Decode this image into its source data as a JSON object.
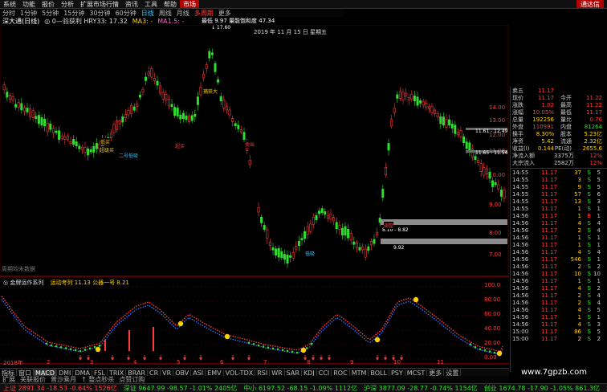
{
  "menu": {
    "items": [
      "系统",
      "功能",
      "报价",
      "分析",
      "扩展市场行情",
      "资讯",
      "工具",
      "帮助",
      "市场"
    ],
    "login": "通达信"
  },
  "periods": {
    "items": [
      "分时",
      "1分钟",
      "5分钟",
      "15分钟",
      "30分钟",
      "60分钟",
      "日线",
      "周线",
      "月线",
      "多周期",
      "更多"
    ],
    "active_index": 6
  },
  "indicator_line": {
    "name": "深大通(日线)",
    "text": "◎ 0—验获利 HRY33: 17.32",
    "ma": "MA3: -",
    "ma2": "MA1.5: -"
  },
  "peak_box": {
    "line1": "最低 9.97  量能饱和度 47.34",
    "line2": "↓ 17.60",
    "date": "2019 年 11 月 15 日 星期五"
  },
  "main_chart": {
    "annotations": [
      {
        "text": "超级买",
        "color": "#ffd000"
      },
      {
        "text": "低买",
        "color": "#ffd000"
      },
      {
        "text": "超买",
        "color": "#ff3b3b"
      },
      {
        "text": "卖出",
        "color": "#ff3b3b"
      },
      {
        "text": "二号低吸",
        "color": "#2ec7ff"
      },
      {
        "text": "捕获大",
        "color": "#ffd000"
      },
      {
        "text": "低吸",
        "color": "#2ec7ff"
      },
      {
        "text": "调整",
        "color": "#ff3b3b"
      }
    ],
    "price_labels": [
      "14.00",
      "13.00",
      "12.00",
      "11.00",
      "10.00",
      "9.00",
      "8.00",
      "7.00"
    ],
    "range_labels": [
      "11.61 - 12.49",
      "11.65 - 11.54",
      "8.10 - 8.82",
      "9.92"
    ],
    "bottom_note": "周期均未数据"
  },
  "sub_chart": {
    "title": "◎ 金牌运作系列",
    "text": "运动考列 11.13 公器一号 8.21",
    "price_labels": [
      "100.0",
      "80.00",
      "60.00",
      "40.00",
      "20.00",
      "0.00"
    ],
    "x_labels": [
      "2018年",
      "2",
      "3",
      "4",
      "5",
      "6",
      "7",
      "8",
      "9",
      "10",
      "11"
    ]
  },
  "quote": {
    "rows": [
      {
        "l1": "卖五",
        "v1": "11.17",
        "l2": "",
        "v2": "",
        "c1": "red",
        "c2": "red"
      },
      {
        "l1": "现价",
        "v1": "11.17",
        "l2": "今开",
        "v2": "11.22",
        "c1": "red",
        "c2": "red"
      },
      {
        "l1": "涨跌",
        "v1": "1.02",
        "l2": "最高",
        "v2": "11.22",
        "c1": "red",
        "c2": "red"
      },
      {
        "l1": "涨幅",
        "v1": "10.05%",
        "l2": "最低",
        "v2": "11.17",
        "c1": "red",
        "c2": "red"
      },
      {
        "l1": "总量",
        "v1": "192256",
        "l2": "量比",
        "v2": "0.76",
        "c1": "yellow",
        "c2": "red"
      },
      {
        "l1": "外盘",
        "v1": "110991",
        "l2": "内盘",
        "v2": "81264",
        "c1": "red",
        "c2": "green"
      },
      {
        "l1": "换手",
        "v1": "8.30%",
        "l2": "股本",
        "v2": "5.23亿",
        "c1": "yellow",
        "c2": "yellow"
      },
      {
        "l1": "净资",
        "v1": "5.42",
        "l2": "流通",
        "v2": "2.32亿",
        "c1": "yellow",
        "c2": "yellow"
      },
      {
        "l1": "收益(I)",
        "v1": "0.144",
        "l2": "PE(动)",
        "v2": "2655.6",
        "c1": "yellow",
        "c2": "yellow"
      },
      {
        "l1": "净流入额",
        "v1": "",
        "l2": "3375万",
        "v2": "12%",
        "c1": "red",
        "c2": "red"
      },
      {
        "l1": "大宗流入",
        "v1": "",
        "l2": "2582万",
        "v2": "12%",
        "c1": "red",
        "c2": "red"
      }
    ]
  },
  "trades": [
    {
      "t": "14:55",
      "p": "11.17",
      "v": "37",
      "s": "S",
      "n": "5"
    },
    {
      "t": "14:55",
      "p": "11.17",
      "v": "3",
      "s": "S",
      "n": "5"
    },
    {
      "t": "14:55",
      "p": "11.17",
      "v": "9",
      "s": "S",
      "n": "5"
    },
    {
      "t": "14:55",
      "p": "11.17",
      "v": "57",
      "s": "S",
      "n": "6"
    },
    {
      "t": "14:55",
      "p": "11.17",
      "v": "13",
      "s": "S",
      "n": "3"
    },
    {
      "t": "14:55",
      "p": "11.17",
      "v": "1",
      "s": "S",
      "n": "1"
    },
    {
      "t": "14:56",
      "p": "11.17",
      "v": "1",
      "s": "B",
      "n": "1"
    },
    {
      "t": "14:56",
      "p": "11.17",
      "v": "4",
      "s": "S",
      "n": "4"
    },
    {
      "t": "14:56",
      "p": "11.17",
      "v": "2",
      "s": "S",
      "n": "4"
    },
    {
      "t": "14:56",
      "p": "11.17",
      "v": "1",
      "s": "S",
      "n": "1"
    },
    {
      "t": "14:56",
      "p": "11.17",
      "v": "1",
      "s": "S",
      "n": "1"
    },
    {
      "t": "14:56",
      "p": "11.17",
      "v": "4",
      "s": "S",
      "n": "4"
    },
    {
      "t": "14:56",
      "p": "11.17",
      "v": "546",
      "s": "S",
      "n": "1"
    },
    {
      "t": "14:56",
      "p": "11.17",
      "v": "2",
      "s": "S",
      "n": "2"
    },
    {
      "t": "14:56",
      "p": "11.17",
      "v": "10",
      "s": "S",
      "n": "10"
    },
    {
      "t": "14:56",
      "p": "11.17",
      "v": "1",
      "s": "S",
      "n": "1"
    },
    {
      "t": "14:56",
      "p": "11.17",
      "v": "4",
      "s": "S",
      "n": "2"
    },
    {
      "t": "14:56",
      "p": "11.17",
      "v": "2",
      "s": "S",
      "n": "4"
    },
    {
      "t": "14:56",
      "p": "11.17",
      "v": "2",
      "s": "S",
      "n": "4"
    },
    {
      "t": "14:56",
      "p": "11.17",
      "v": "4",
      "s": "S",
      "n": "5"
    },
    {
      "t": "14:56",
      "p": "11.17",
      "v": "1",
      "s": "S",
      "n": "1"
    },
    {
      "t": "14:56",
      "p": "11.17",
      "v": "4",
      "s": "S",
      "n": "3"
    },
    {
      "t": "15:00",
      "p": "11.17",
      "v": "86",
      "s": "S",
      "n": "5"
    },
    {
      "t": "15:00",
      "p": "11.17",
      "v": "2",
      "s": "S",
      "n": "2"
    }
  ],
  "indicator_tabs": {
    "items": [
      "指标",
      "窗口",
      "MACD",
      "DMI",
      "DMA",
      "FSL",
      "TRIX",
      "BRAR",
      "CR",
      "VR",
      "OBV",
      "ASI",
      "EMV",
      "VOL-TDX",
      "RSI",
      "WR",
      "SAR",
      "KDJ",
      "CCI",
      "ROC",
      "MTM",
      "BOLL",
      "PSY",
      "MCST",
      "更多",
      "设置"
    ],
    "selected_index": 2
  },
  "lower_tabs": [
    "扩展",
    "关联报价",
    "普沙乘月",
    "↑ 整点秒杀",
    "点赞订购"
  ],
  "status": [
    {
      "text": "上证 2891.34 -18.53 -0.64% 1526亿",
      "color": "#ff3b3b"
    },
    {
      "text": "深证 9647.99 -98.57 -1.01% 2405亿",
      "color": "#2fdf2f"
    },
    {
      "text": "中小 6197.52 -68.15 -1.09% 1112亿",
      "color": "#2fdf2f"
    },
    {
      "text": "沪深 3877.09 -28.77 -0.74% 1154亿",
      "color": "#2fdf2f"
    },
    {
      "text": "创业 1674.78 -17.90 -1.05% 861.3亿",
      "color": "#2fdf2f"
    },
    {
      "text": "北京行情主站I",
      "color": "#ffd000"
    }
  ],
  "watermark": "www.7gpzb.com",
  "colors": {
    "up": "#ff3b3b",
    "down": "#2fdf2f",
    "accent": "#ffd000",
    "info": "#2ec7ff"
  }
}
